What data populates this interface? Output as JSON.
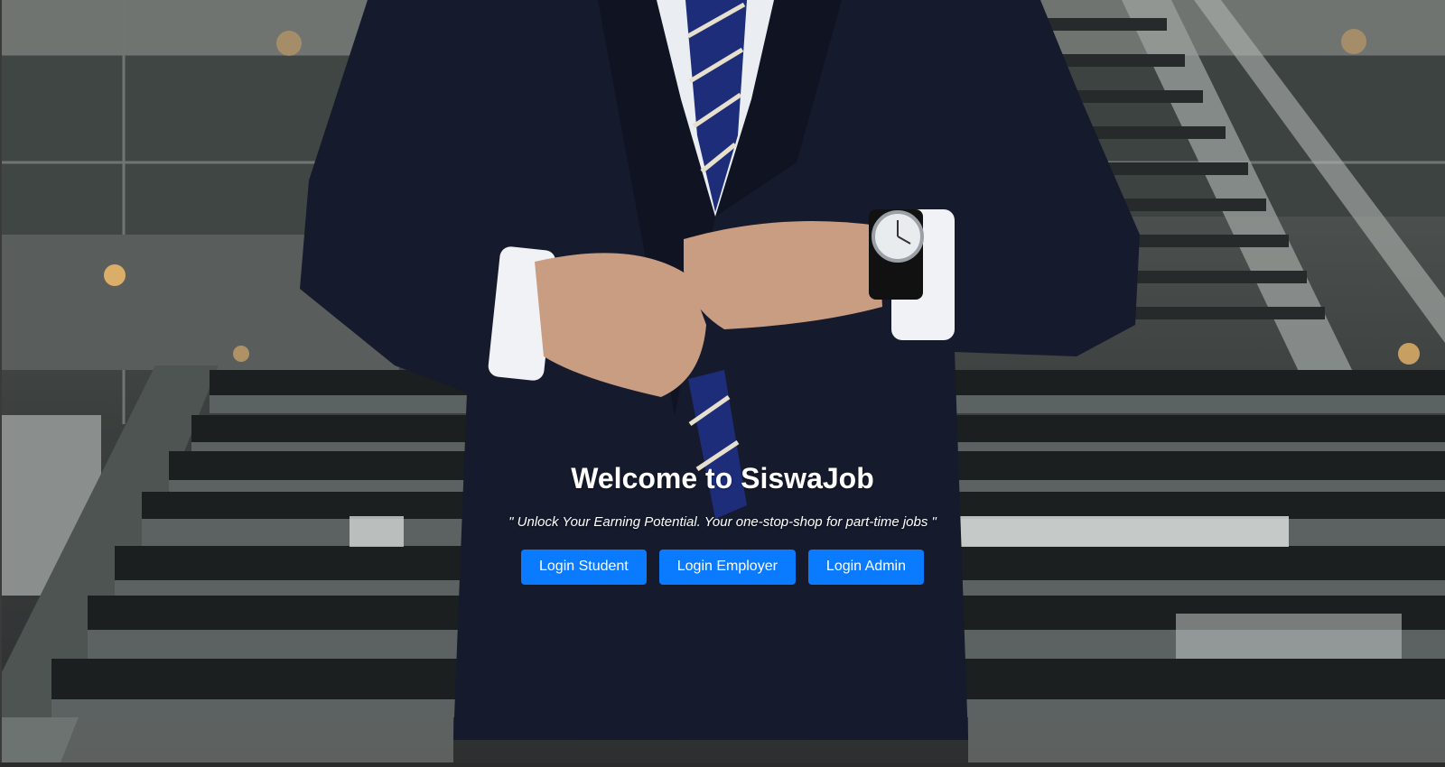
{
  "hero": {
    "title": "Welcome to SiswaJob",
    "tagline": "\" Unlock Your Earning Potential. Your one-stop-shop for part-time jobs \""
  },
  "buttons": {
    "login_student": "Login Student",
    "login_employer": "Login Employer",
    "login_admin": "Login Admin"
  },
  "colors": {
    "button_bg": "#0a7bff",
    "text": "#ffffff"
  }
}
